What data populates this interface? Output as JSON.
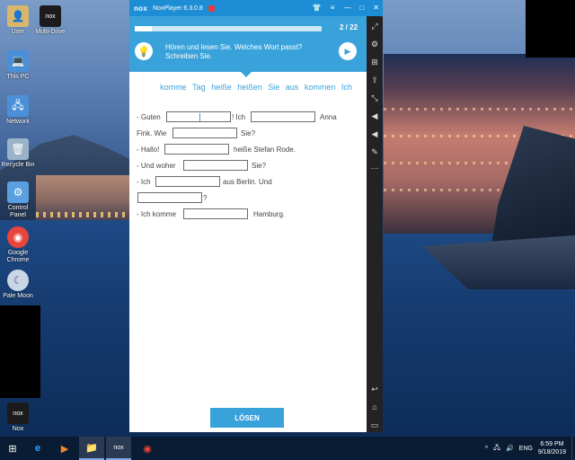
{
  "desktop": {
    "icons": [
      {
        "label": "User",
        "glyph": "👤",
        "color": "#d9b76a"
      },
      {
        "label": "Multi-Drive",
        "glyph": "nox",
        "color": "#1b1b1b"
      },
      {
        "label": "This PC",
        "glyph": "💻",
        "color": "#4a90d9"
      },
      {
        "label": "Network",
        "glyph": "🖧",
        "color": "#4a90d9"
      },
      {
        "label": "Recycle Bin",
        "glyph": "🗑",
        "color": "#9bb3c9"
      },
      {
        "label": "Control Panel",
        "glyph": "⚙",
        "color": "#5aa0e0"
      },
      {
        "label": "Google Chrome",
        "glyph": "◉",
        "color": "#e8453c"
      },
      {
        "label": "Pale Moon",
        "glyph": "☾",
        "color": "#c9d6e6"
      },
      {
        "label": "Nox",
        "glyph": "nox",
        "color": "#1b1b1b"
      }
    ]
  },
  "nox_window": {
    "logo": "nox",
    "title": "NoxPlayer 6.3.0.8",
    "controls": [
      "👕",
      "≡",
      "—",
      "□",
      "✕"
    ],
    "side_icons": [
      "⤢",
      "⚙",
      "⊞",
      "⇧",
      "⤡",
      "◀",
      "◀",
      "✎",
      "⋯",
      "↩",
      "⌂",
      "▭"
    ]
  },
  "lesson": {
    "progress_fraction": 0.09,
    "progress_label": "2 / 22",
    "instruction": "Hören und lesen Sie. Welches Wort passt? Schreiben Sie.",
    "word_bank": [
      "komme",
      "Tag",
      "heiße",
      "heißen",
      "Sie",
      "aus",
      "kommen",
      "Ich"
    ],
    "dialog": {
      "l1_a": "- Guten",
      "l1_b": "! Ich",
      "l1_c": "Anna",
      "l2_a": "Fink. Wie",
      "l2_b": "Sie?",
      "l3_a": "- Hallo!",
      "l3_b": "heiße Stefan Rode.",
      "l4_a": "- Und woher",
      "l4_b": "Sie?",
      "l5_a": "- Ich",
      "l5_b": "aus Berlin. Und",
      "l6_b": "?",
      "l7_a": "- Ich komme",
      "l7_b": "Hamburg."
    },
    "solve_label": "LÖSEN"
  },
  "taskbar": {
    "start_icon": "⊞",
    "apps": [
      "e",
      "▶",
      "📁",
      "nox",
      "◉"
    ],
    "tray": {
      "chevron": "^",
      "network": "🖧",
      "volume": "🔊",
      "lang": "ENG",
      "time": "6:59 PM",
      "date": "9/18/2019"
    }
  }
}
